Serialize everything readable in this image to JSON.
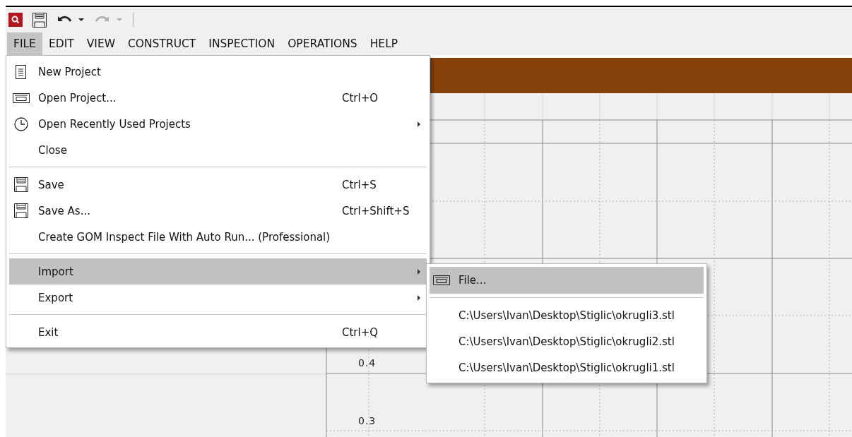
{
  "toolbar": {
    "buttons": [
      {
        "kind": "save",
        "disabled": false
      },
      {
        "kind": "undo",
        "disabled": false
      },
      {
        "kind": "redo",
        "disabled": true
      }
    ]
  },
  "menubar": [
    {
      "label": "FILE",
      "selected": true
    },
    {
      "label": "EDIT",
      "selected": false
    },
    {
      "label": "VIEW",
      "selected": false
    },
    {
      "label": "CONSTRUCT",
      "selected": false
    },
    {
      "label": "INSPECTION",
      "selected": false
    },
    {
      "label": "OPERATIONS",
      "selected": false
    },
    {
      "label": "HELP",
      "selected": false
    }
  ],
  "file_menu": {
    "groups": [
      [
        {
          "label": "New Project",
          "selected": false,
          "submenu": false
        },
        {
          "label": "Open Project...",
          "shortcut": "Ctrl+O",
          "selected": false,
          "submenu": false
        },
        {
          "label": "Open Recently Used Projects",
          "selected": false,
          "submenu": true
        },
        {
          "label": "Close",
          "selected": false,
          "submenu": false
        }
      ],
      [
        {
          "label": "Save",
          "shortcut": "Ctrl+S",
          "selected": false,
          "submenu": false
        },
        {
          "label": "Save As...",
          "shortcut": "Ctrl+Shift+S",
          "selected": false,
          "submenu": false
        },
        {
          "label": "Create GOM Inspect File With Auto Run... (Professional)",
          "selected": false,
          "submenu": false
        }
      ],
      [
        {
          "label": "Import",
          "selected": true,
          "submenu": true
        },
        {
          "label": "Export",
          "selected": false,
          "submenu": true
        }
      ],
      [
        {
          "label": "Exit",
          "shortcut": "Ctrl+Q",
          "selected": false,
          "submenu": false
        }
      ]
    ]
  },
  "import_submenu": {
    "groups": [
      [
        {
          "label": "File...",
          "selected": true
        }
      ],
      [
        {
          "label": "C:\\Users\\Ivan\\Desktop\\Stiglic\\okrugli3.stl",
          "selected": false
        },
        {
          "label": "C:\\Users\\Ivan\\Desktop\\Stiglic\\okrugli2.stl",
          "selected": false
        },
        {
          "label": "C:\\Users\\Ivan\\Desktop\\Stiglic\\okrugli1.stl",
          "selected": false
        }
      ]
    ]
  },
  "chart_axis_labels": [
    "0.4",
    "0.3"
  ]
}
